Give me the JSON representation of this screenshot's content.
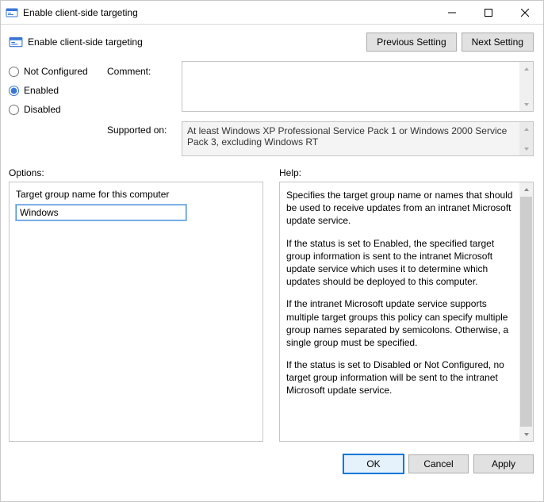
{
  "window": {
    "title": "Enable client-side targeting"
  },
  "header": {
    "description": "Enable client-side targeting",
    "prev_btn": "Previous Setting",
    "next_btn": "Next Setting"
  },
  "config": {
    "comment_label": "Comment:",
    "supported_label": "Supported on:",
    "supported_text": "At least Windows XP Professional Service Pack 1 or Windows 2000 Service Pack 3, excluding Windows RT",
    "radios": {
      "not_configured": "Not Configured",
      "enabled": "Enabled",
      "disabled": "Disabled",
      "selected": "enabled"
    }
  },
  "labels": {
    "options": "Options:",
    "help": "Help:"
  },
  "options": {
    "target_group_label": "Target group name for this computer",
    "target_group_value": "Windows"
  },
  "help": {
    "p1": "Specifies the target group name or names that should be used to receive updates from an intranet Microsoft update service.",
    "p2": "If the status is set to Enabled, the specified target group information is sent to the intranet Microsoft update service which uses it to determine which updates should be deployed to this computer.",
    "p3": "If the intranet Microsoft update service supports multiple target groups this policy can specify multiple group names separated by semicolons. Otherwise, a single group must be specified.",
    "p4": "If the status is set to Disabled or Not Configured, no target group information will be sent to the intranet Microsoft update service."
  },
  "buttons": {
    "ok": "OK",
    "cancel": "Cancel",
    "apply": "Apply"
  }
}
